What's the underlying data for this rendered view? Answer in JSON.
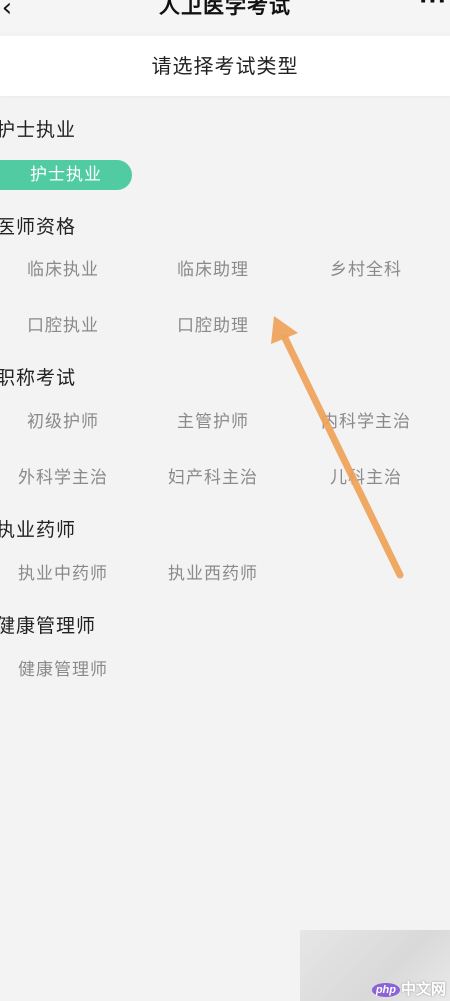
{
  "header": {
    "back_icon": "‹",
    "title": "人卫医学考试",
    "more_icon": "···"
  },
  "subheader": {
    "title": "请选择考试类型"
  },
  "sections": [
    {
      "title": "护士执业",
      "options": [
        "护士执业"
      ],
      "selected": "护士执业"
    },
    {
      "title": "医师资格",
      "options": [
        "临床执业",
        "临床助理",
        "乡村全科",
        "口腔执业",
        "口腔助理"
      ]
    },
    {
      "title": "职称考试",
      "options": [
        "初级护师",
        "主管护师",
        "内科学主治",
        "外科学主治",
        "妇产科主治",
        "儿科主治"
      ]
    },
    {
      "title": "执业药师",
      "options": [
        "执业中药师",
        "执业西药师"
      ]
    },
    {
      "title": "健康管理师",
      "options": [
        "健康管理师"
      ]
    }
  ],
  "colors": {
    "accent": "#51cba1",
    "annotation_arrow": "#f0a25a",
    "background": "#f3f3f3"
  },
  "watermark": {
    "logo_php": "php",
    "logo_text": "中文网"
  }
}
